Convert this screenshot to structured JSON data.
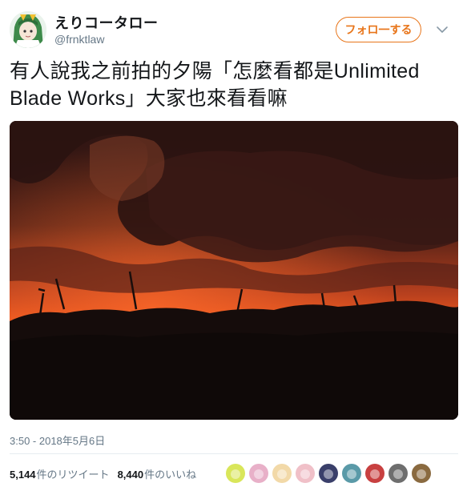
{
  "user": {
    "display_name": "えりコータロー",
    "handle": "@frnktlaw"
  },
  "follow_button": {
    "label": "フォロ一する"
  },
  "tweet": {
    "text": "有人說我之前拍的夕陽「怎麼看都是Unlimited Blade Works」大家也來看看嘛",
    "timestamp": "3:50 - 2018年5月6日"
  },
  "stats": {
    "retweets_count": "5,144",
    "retweets_label": "件のリツイート",
    "likes_count": "8,440",
    "likes_label": "件のいいね"
  },
  "colors": {
    "accent": "#e8751a",
    "muted": "#657786",
    "text": "#14171a",
    "sky_glow": "#e4501e",
    "sky_dark": "#2a1513"
  },
  "likers": [
    {
      "icon": "liker-avatar",
      "color": "#d9e65a"
    },
    {
      "icon": "liker-avatar",
      "color": "#e8b0c8"
    },
    {
      "icon": "liker-avatar",
      "color": "#f2d9a8"
    },
    {
      "icon": "liker-avatar",
      "color": "#f0c0c8"
    },
    {
      "icon": "liker-avatar",
      "color": "#3a3f6a"
    },
    {
      "icon": "liker-avatar",
      "color": "#5a9aa8"
    },
    {
      "icon": "liker-avatar",
      "color": "#c84040"
    },
    {
      "icon": "liker-avatar",
      "color": "#6e6e6e"
    },
    {
      "icon": "liker-avatar",
      "color": "#8a6a40"
    }
  ]
}
